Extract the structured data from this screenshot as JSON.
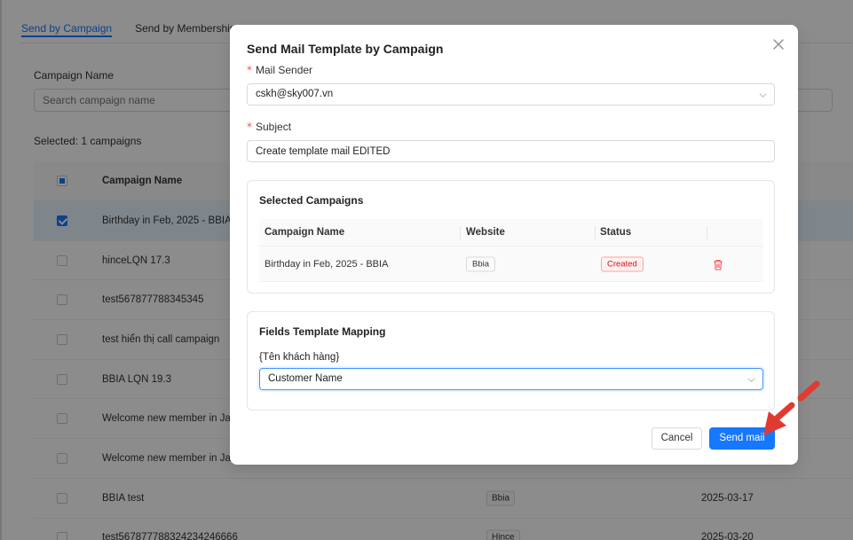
{
  "background": {
    "tabs": [
      {
        "label": "Send by Campaign",
        "active": true
      },
      {
        "label": "Send by Membership",
        "active": false
      }
    ],
    "campaign_name_label": "Campaign Name",
    "search_placeholder": "Search campaign name",
    "selected_text": "Selected: 1 campaigns",
    "table_header": "Campaign Name",
    "rows": [
      {
        "name": "Birthday in Feb, 2025 - BBIA",
        "checked": true,
        "website": "",
        "date": ""
      },
      {
        "name": "hinceLQN 17.3",
        "checked": false,
        "website": "",
        "date": ""
      },
      {
        "name": "test567877788345345",
        "checked": false,
        "website": "",
        "date": ""
      },
      {
        "name": "test hiển thị call campaign",
        "checked": false,
        "website": "",
        "date": ""
      },
      {
        "name": "BBIA LQN 19.3",
        "checked": false,
        "website": "",
        "date": ""
      },
      {
        "name": "Welcome new member in Jan",
        "checked": false,
        "website": "",
        "date": ""
      },
      {
        "name": "Welcome new member in Jan",
        "checked": false,
        "website": "",
        "date": ""
      },
      {
        "name": "BBIA test",
        "checked": false,
        "website": "Bbia",
        "date": "2025-03-17"
      },
      {
        "name": "test567877788324234246666",
        "checked": false,
        "website": "Hince",
        "date": "2025-03-20"
      }
    ]
  },
  "modal": {
    "title": "Send Mail Template by Campaign",
    "required_mark": "*",
    "mail_sender_label": "Mail Sender",
    "mail_sender_value": "cskh@sky007.vn",
    "subject_label": "Subject",
    "subject_value": "Create template mail EDITED",
    "selected_campaigns": {
      "title": "Selected Campaigns",
      "headers": {
        "name": "Campaign Name",
        "website": "Website",
        "status": "Status"
      },
      "rows": [
        {
          "name": "Birthday in Feb, 2025 - BBIA",
          "website": "Bbia",
          "status": "Created"
        }
      ]
    },
    "mapping": {
      "title": "Fields Template Mapping",
      "field_label": "{Tên khách hàng}",
      "field_value": "Customer Name"
    },
    "buttons": {
      "cancel": "Cancel",
      "send": "Send mail"
    }
  },
  "colors": {
    "primary": "#1677ff",
    "danger": "#ff4d4f",
    "annotation_arrow": "#f0433a"
  }
}
